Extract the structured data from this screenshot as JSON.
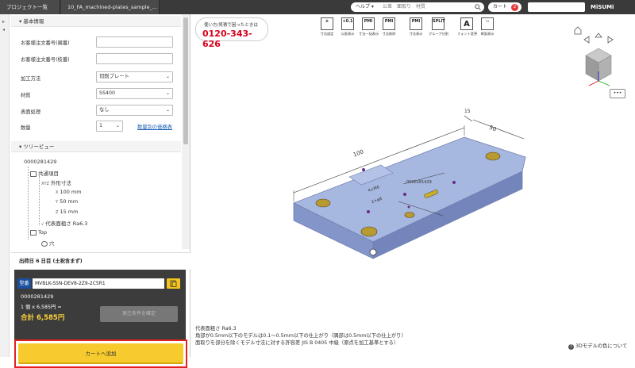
{
  "topbar": {
    "project_tab": "プロジェクト一覧",
    "file_tab": "10_FA_machined-plates_sample_...",
    "help_label": "ヘルプ",
    "search_placeholder": "公差　面取り　材質",
    "cart_label": "カート",
    "cart_count": "2",
    "logo": "MiSUMi"
  },
  "left": {
    "basic_info_header": "基本情報",
    "fields": {
      "customer_order_no_label": "お客様注文番号(親番)",
      "customer_order_sub_label": "お客様注文番号(枝番)",
      "process_label": "加工方法",
      "process_value": "切削プレート",
      "material_label": "材質",
      "material_value": "SS400",
      "surface_label": "表面処理",
      "surface_value": "なし",
      "qty_label": "数量",
      "qty_value": "1",
      "price_link": "数量別の価格表"
    },
    "tree_header": "ツリービュー",
    "tree": {
      "root": "0000281429",
      "common": "共通項目",
      "dims": "外形寸法",
      "x": "100 mm",
      "y": "50 mm",
      "z": "15 mm",
      "roughness": "代表面粗さ Ra6.3",
      "top": "Top",
      "hole": "穴"
    },
    "ship_info": "出荷日 6 日目 (土祝含まず)",
    "order": {
      "model_badge": "型番",
      "model_number": "MVBLK-SSN-DEV8-2Z9-2C5R1",
      "code": "0000281429",
      "unit_price": "1 個 x 6,585円 =",
      "total": "合計 6,585円",
      "confirm_button": "発注条件を確定",
      "add_to_cart": "カートへ追加"
    }
  },
  "viewer": {
    "phone_caption": "使い方/見積で困ったときは",
    "phone_number": "0120-343-626",
    "tools": [
      {
        "icon": "±",
        "label": "寸法設定"
      },
      {
        "icon": "+0.1",
        "label": "公差表示"
      },
      {
        "icon": "PMI",
        "label": "寸法一括表示"
      },
      {
        "icon": "PMI",
        "label": "寸法削除"
      },
      {
        "icon": "PMI",
        "label": "寸法表示"
      },
      {
        "icon": "SPLIT",
        "label": "グループ分割"
      },
      {
        "icon": "A",
        "label": "フォント変更"
      },
      {
        "icon": "▭",
        "label": "断面表示"
      }
    ],
    "dims_labels": {
      "length": "100",
      "width": "50",
      "height": "15",
      "callout1": "0000281429",
      "callout2": "4×M6",
      "callout3": "2×φ8"
    },
    "notes": [
      "代表面粗さ Ra6.3",
      "角部が0.5mm以下のモデルは0.1～0.5mm以下の仕上がり（隅部は0.5mm以下の仕上がり）",
      "面取りを部分を除くモデル寸法に対する許容差 JIS B 0405 中級（原点を加工基準とする）"
    ],
    "color_help": "3Dモデルの色について",
    "more_button": "•••"
  }
}
